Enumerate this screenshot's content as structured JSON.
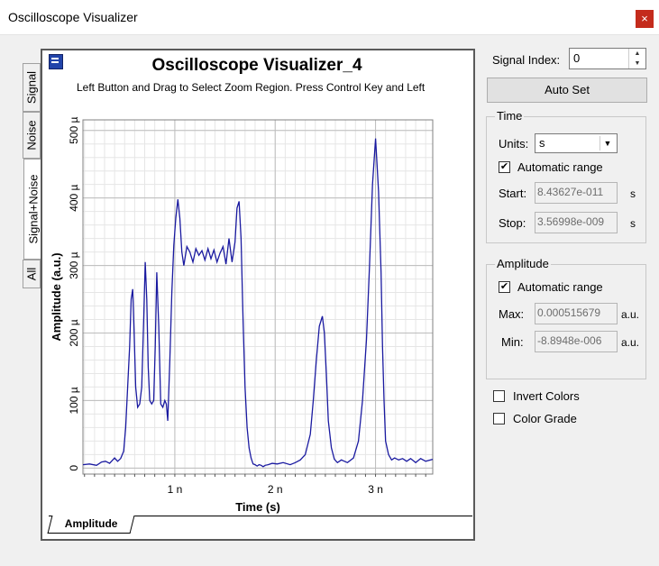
{
  "window": {
    "title": "Oscilloscope Visualizer",
    "close_glyph": "×"
  },
  "tabs": [
    {
      "label": "Signal",
      "active": false
    },
    {
      "label": "Noise",
      "active": false
    },
    {
      "label": "Signal+Noise",
      "active": true
    },
    {
      "label": "All",
      "active": false
    }
  ],
  "plot": {
    "title": "Oscilloscope Visualizer_4",
    "subtitle": "Left Button and Drag to Select Zoom Region. Press Control Key and Left",
    "bottom_tab": "Amplitude"
  },
  "chart_data": {
    "type": "line",
    "xlabel": "Time (s)",
    "ylabel": "Amplitude (a.u.)",
    "xlim": [
      8.43627e-11,
      3.56998e-09
    ],
    "ylim": [
      -8.8948e-06,
      0.000515679
    ],
    "x_ticks": [
      {
        "value": 1e-09,
        "label": "1 n"
      },
      {
        "value": 2e-09,
        "label": "2 n"
      },
      {
        "value": 3e-09,
        "label": "3 n"
      }
    ],
    "y_ticks": [
      {
        "value": 0,
        "label": "0"
      },
      {
        "value": 0.0001,
        "label": "100 µ"
      },
      {
        "value": 0.0002,
        "label": "200 µ"
      },
      {
        "value": 0.0003,
        "label": "300 µ"
      },
      {
        "value": 0.0004,
        "label": "400 µ"
      },
      {
        "value": 0.0005,
        "label": "500 µ"
      }
    ],
    "grid": true,
    "color": "#1a1aa0",
    "series": [
      {
        "x": [
          8.4e-11,
          1.5e-10,
          2.2e-10,
          2.7e-10,
          3.1e-10,
          3.5e-10,
          4e-10,
          4.3e-10,
          4.6e-10,
          4.9e-10,
          5.1e-10,
          5.3e-10,
          5.5e-10,
          5.65e-10,
          5.8e-10,
          5.95e-10,
          6.1e-10,
          6.3e-10,
          6.5e-10,
          6.7e-10,
          6.9e-10,
          7.05e-10,
          7.2e-10,
          7.35e-10,
          7.5e-10,
          7.7e-10,
          7.9e-10,
          8.05e-10,
          8.2e-10,
          8.4e-10,
          8.6e-10,
          8.8e-10,
          9e-10,
          9.15e-10,
          9.3e-10,
          9.5e-10,
          9.7e-10,
          9.9e-10,
          1.01e-09,
          1.03e-09,
          1.05e-09,
          1.07e-09,
          1.09e-09,
          1.12e-09,
          1.15e-09,
          1.18e-09,
          1.21e-09,
          1.24e-09,
          1.27e-09,
          1.3e-09,
          1.33e-09,
          1.36e-09,
          1.39e-09,
          1.42e-09,
          1.45e-09,
          1.48e-09,
          1.51e-09,
          1.54e-09,
          1.57e-09,
          1.6e-09,
          1.62e-09,
          1.64e-09,
          1.66e-09,
          1.68e-09,
          1.7e-09,
          1.72e-09,
          1.74e-09,
          1.76e-09,
          1.78e-09,
          1.8e-09,
          1.82e-09,
          1.84e-09,
          1.86e-09,
          1.88e-09,
          1.9e-09,
          1.93e-09,
          1.97e-09,
          2.02e-09,
          2.08e-09,
          2.15e-09,
          2.2e-09,
          2.25e-09,
          2.3e-09,
          2.35e-09,
          2.38e-09,
          2.41e-09,
          2.44e-09,
          2.47e-09,
          2.49e-09,
          2.51e-09,
          2.53e-09,
          2.56e-09,
          2.59e-09,
          2.62e-09,
          2.66e-09,
          2.72e-09,
          2.78e-09,
          2.83e-09,
          2.87e-09,
          2.91e-09,
          2.94e-09,
          2.97e-09,
          3e-09,
          3.03e-09,
          3.055e-09,
          3.07e-09,
          3.085e-09,
          3.1e-09,
          3.13e-09,
          3.16e-09,
          3.19e-09,
          3.23e-09,
          3.27e-09,
          3.31e-09,
          3.35e-09,
          3.4e-09,
          3.45e-09,
          3.5e-09,
          3.57e-09
        ],
        "y": [
          5e-06,
          6e-06,
          4e-06,
          9e-06,
          1e-05,
          7e-06,
          1.5e-05,
          1e-05,
          1.4e-05,
          2.5e-05,
          6e-05,
          0.00012,
          0.00018,
          0.00025,
          0.000265,
          0.0002,
          0.00012,
          9e-05,
          9.5e-05,
          0.00012,
          0.00022,
          0.000305,
          0.00025,
          0.00015,
          0.0001,
          9.5e-05,
          0.0001,
          0.00018,
          0.00029,
          0.00021,
          9.5e-05,
          9e-05,
          0.0001,
          9.5e-05,
          7e-05,
          0.00016,
          0.00026,
          0.00033,
          0.00037,
          0.000398,
          0.00037,
          0.00032,
          0.0003,
          0.000328,
          0.00032,
          0.000305,
          0.000325,
          0.000315,
          0.000322,
          0.000308,
          0.000325,
          0.00031,
          0.000323,
          0.000305,
          0.000318,
          0.000328,
          0.000302,
          0.00034,
          0.000305,
          0.000335,
          0.000385,
          0.000395,
          0.00034,
          0.00022,
          0.00012,
          6e-05,
          3e-05,
          1.5e-05,
          6e-06,
          5e-06,
          3e-06,
          5e-06,
          4e-06,
          2e-06,
          4e-06,
          5e-06,
          7e-06,
          6e-06,
          8e-06,
          5e-06,
          8e-06,
          1.2e-05,
          2e-05,
          5e-05,
          0.0001,
          0.00016,
          0.00021,
          0.000225,
          0.0002,
          0.00014,
          7e-05,
          3e-05,
          1.3e-05,
          8e-06,
          1.2e-05,
          8e-06,
          1.5e-05,
          4e-05,
          0.0001,
          0.00019,
          0.0003,
          0.00042,
          0.000488,
          0.00041,
          0.00029,
          0.00018,
          0.0001,
          4e-05,
          2e-05,
          1.2e-05,
          1.5e-05,
          1.2e-05,
          1.4e-05,
          1e-05,
          1.4e-05,
          8e-06,
          1.4e-05,
          1e-05,
          1.3e-05
        ]
      }
    ]
  },
  "controls": {
    "signal_index_label": "Signal Index:",
    "signal_index_value": "0",
    "auto_set_label": "Auto Set",
    "time": {
      "group_label": "Time",
      "units_label": "Units:",
      "units_value": "s",
      "auto_range_label": "Automatic range",
      "auto_range_checked": true,
      "start_label": "Start:",
      "start_value": "8.43627e-011",
      "start_unit": "s",
      "stop_label": "Stop:",
      "stop_value": "3.56998e-009",
      "stop_unit": "s"
    },
    "amplitude": {
      "group_label": "Amplitude",
      "auto_range_label": "Automatic range",
      "auto_range_checked": true,
      "max_label": "Max:",
      "max_value": "0.000515679",
      "max_unit": "a.u.",
      "min_label": "Min:",
      "min_value": "-8.8948e-006",
      "min_unit": "a.u."
    },
    "invert_colors_label": "Invert Colors",
    "invert_colors_checked": false,
    "color_grade_label": "Color Grade",
    "color_grade_checked": false
  },
  "icons": {
    "check": "✔",
    "dropdown": "▼",
    "spin_up": "▲",
    "spin_down": "▼"
  }
}
